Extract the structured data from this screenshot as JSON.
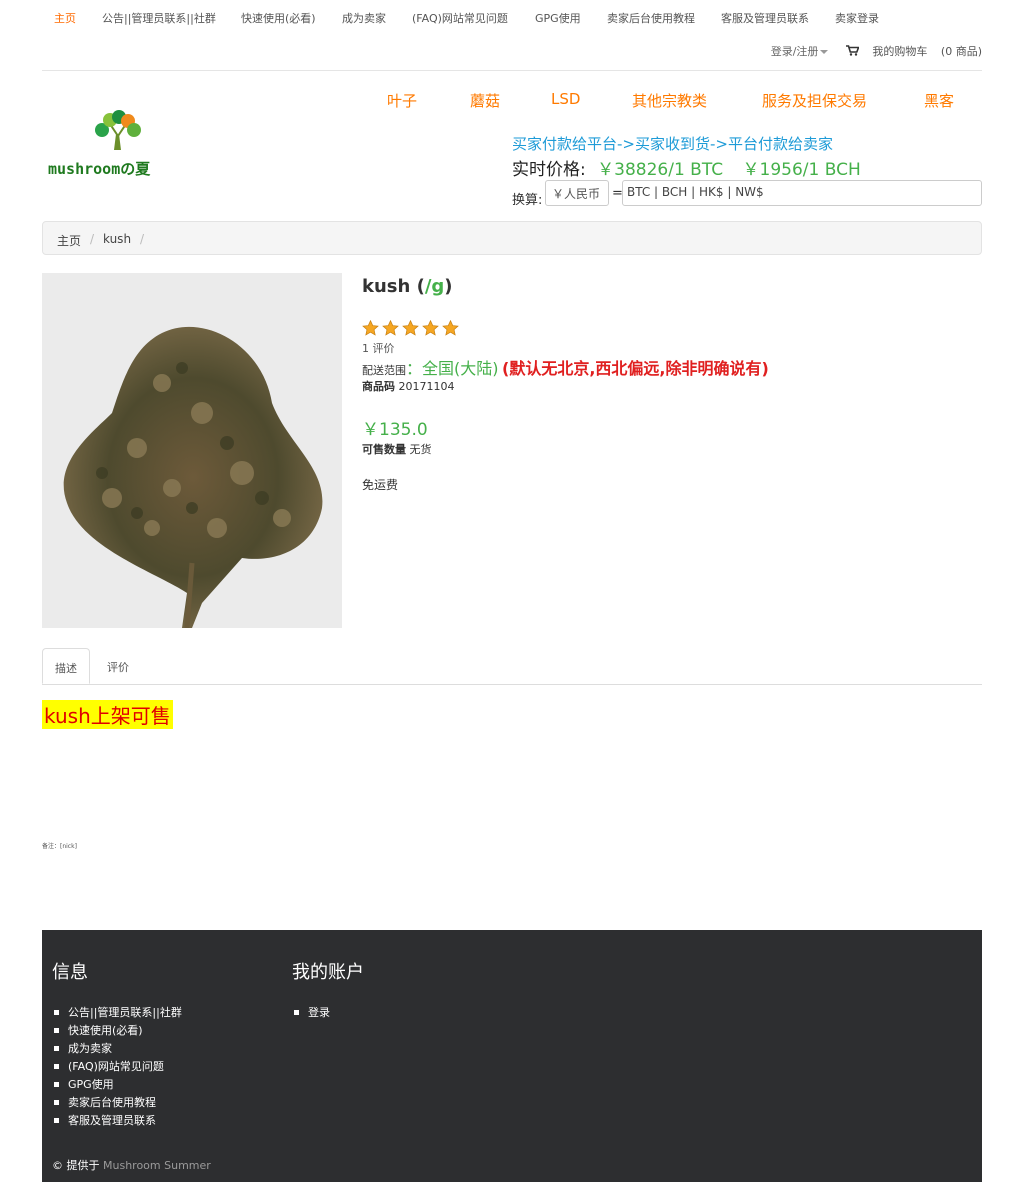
{
  "top_nav": {
    "items": [
      "主页",
      "公告||管理员联系||社群",
      "快速使用(必看)",
      "成为卖家",
      "(FAQ)网站常见问题",
      "GPG使用",
      "卖家后台使用教程",
      "客服及管理员联系",
      "卖家登录"
    ],
    "active_color": "#ff6a00"
  },
  "user_bar": {
    "login": "登录/注册",
    "cart": "我的购物车",
    "cart_count": "(0 商品)"
  },
  "logo": {
    "text": "mushroomの夏"
  },
  "main_nav": {
    "items": [
      "叶子",
      "蘑菇",
      "LSD",
      "其他宗教类",
      "服务及担保交易",
      "黑客"
    ]
  },
  "header_info": {
    "escrow": "买家付款给平台->买家收到货->平台付款给卖家",
    "price_label": "实时价格:",
    "btc_price": "￥38826/1 BTC",
    "bch_price": "￥1956/1 BCH",
    "convert_label": "换算:",
    "rmb_placeholder": "￥人民币",
    "equals": "=",
    "crypto_placeholder": "BTC | BCH | HK$ | NW$"
  },
  "breadcrumb": {
    "home": "主页",
    "current": "kush",
    "sep": "/"
  },
  "product": {
    "name": "kush",
    "unit": "/g",
    "rating": 5,
    "rating_max": 5,
    "reviews": "1 评价",
    "ship_label": "配送范围",
    "ship_range": "：全国(大陆)",
    "ship_note": "(默认无北京,西北偏远,除非明确说有)",
    "sku_label": "商品码",
    "sku": "20171104",
    "price": "￥135.0",
    "stock_label": "可售数量",
    "stock": "无货",
    "shipping_fee": "免运费"
  },
  "tabs": [
    "描述",
    "评价"
  ],
  "description": {
    "headline": "kush上架可售",
    "remark": "备注：[nick]"
  },
  "footer": {
    "info_title": "信息",
    "info_links": [
      "公告||管理员联系||社群",
      "快速使用(必看)",
      "成为卖家",
      "(FAQ)网站常见问题",
      "GPG使用",
      "卖家后台使用教程",
      "客服及管理员联系"
    ],
    "account_title": "我的账户",
    "account_links": [
      "登录"
    ],
    "copyright_prefix": "© 提供于",
    "copyright_brand": "Mushroom Summer"
  },
  "colors": {
    "accent_orange": "#ff7a00",
    "link_blue": "#1e9bd7",
    "price_green": "#45b04a",
    "warning_red": "#e02020",
    "footer_bg": "#2d2e30"
  }
}
